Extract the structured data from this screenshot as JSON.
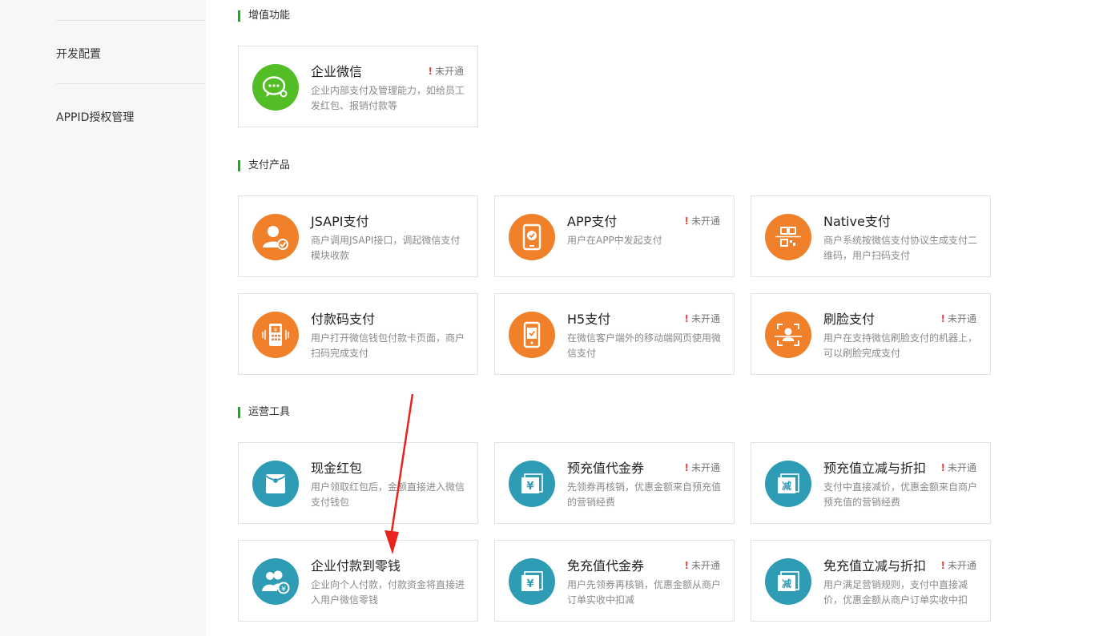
{
  "sidebar": {
    "items": [
      {
        "label": "开发配置"
      },
      {
        "label": "APPID授权管理"
      }
    ]
  },
  "sections": [
    {
      "title": "增值功能"
    },
    {
      "title": "支付产品"
    },
    {
      "title": "运营工具"
    }
  ],
  "cards": {
    "wework": {
      "title": "企业微信",
      "desc": "企业内部支付及管理能力，如给员工发红包、报销付款等",
      "status": "未开通",
      "icon": "wechat-work-icon"
    },
    "jsapi": {
      "title": "JSAPI支付",
      "desc": "商户调用JSAPI接口，调起微信支付模块收款",
      "icon": "user-check-icon"
    },
    "app": {
      "title": "APP支付",
      "desc": "用户在APP中发起支付",
      "status": "未开通",
      "icon": "phone-pay-icon"
    },
    "native": {
      "title": "Native支付",
      "desc": "商户系统按微信支付协议生成支付二维码，用户扫码支付",
      "icon": "qrcode-scan-icon"
    },
    "paycode": {
      "title": "付款码支付",
      "desc": "用户打开微信钱包付款卡页面，商户扫码完成支付",
      "icon": "pos-terminal-icon"
    },
    "h5": {
      "title": "H5支付",
      "desc": "在微信客户端外的移动端网页使用微信支付",
      "status": "未开通",
      "icon": "mobile-check-icon"
    },
    "face": {
      "title": "刷脸支付",
      "desc": "用户在支持微信刷脸支付的机器上，可以刷脸完成支付",
      "status": "未开通",
      "icon": "face-scan-icon"
    },
    "redpack": {
      "title": "现金红包",
      "desc": "用户领取红包后，金额直接进入微信支付钱包",
      "icon": "red-envelope-icon"
    },
    "prepaid_voucher": {
      "title": "预充值代金券",
      "desc": "先领券再核销，优惠金额来自预充值的营销经费",
      "status": "未开通",
      "icon": "voucher-yen-icon"
    },
    "prepaid_discount": {
      "title": "预充值立减与折扣",
      "desc": "支付中直接减价，优惠金额来自商户预充值的营销经费",
      "status": "未开通",
      "icon": "discount-ticket-icon"
    },
    "transfer": {
      "title": "企业付款到零钱",
      "desc": "企业向个人付款，付款资金将直接进入用户微信零钱",
      "icon": "people-yen-icon"
    },
    "free_voucher": {
      "title": "免充值代金券",
      "desc": "用户先领券再核销，优惠金额从商户订单实收中扣减",
      "status": "未开通",
      "icon": "voucher-yen-icon"
    },
    "free_discount": {
      "title": "免充值立减与折扣",
      "desc": "用户满足营销规则，支付中直接减价，优惠金额从商户订单实收中扣",
      "status": "未开通",
      "icon": "discount-ticket-icon"
    }
  },
  "glyphs": {
    "status_mark": "!",
    "yen": "¥",
    "discount": "减"
  },
  "colors": {
    "accent_green": "#1aad19",
    "icon_green": "#53bd25",
    "icon_orange": "#f0802a",
    "icon_teal": "#2e9cb4",
    "alert_red": "#e64340",
    "annotation_arrow": "#e8231e"
  }
}
